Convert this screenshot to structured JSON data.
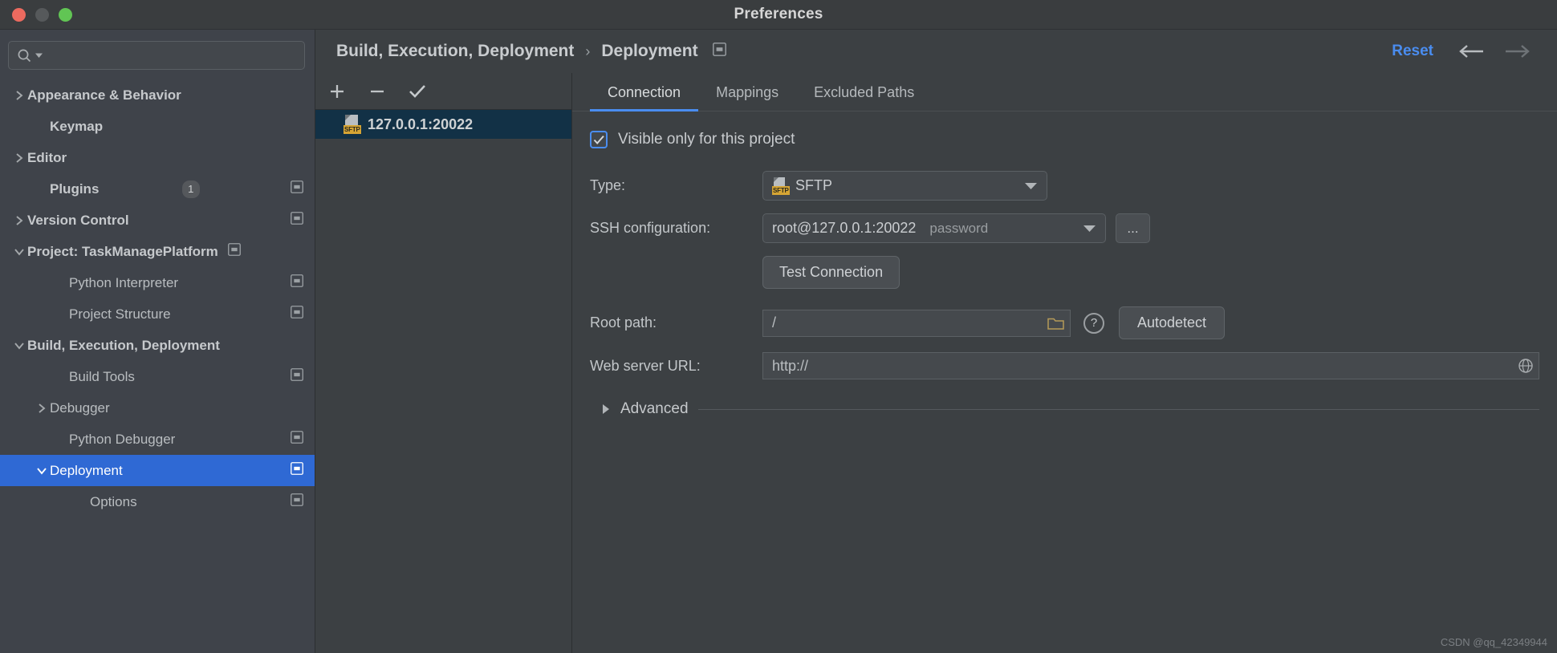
{
  "window": {
    "title": "Preferences",
    "traffic_lights": [
      "close-red",
      "minimize-yellow",
      "zoom-green"
    ]
  },
  "sidebar": {
    "search": {
      "value": "",
      "placeholder": ""
    },
    "items": [
      {
        "label": "Appearance & Behavior",
        "arrow": "right",
        "bold": true,
        "indent": 14,
        "badge": null,
        "copy": false
      },
      {
        "label": "Keymap",
        "arrow": "none",
        "bold": true,
        "indent": 42,
        "badge": null,
        "copy": false
      },
      {
        "label": "Editor",
        "arrow": "right",
        "bold": true,
        "indent": 14,
        "badge": null,
        "copy": false
      },
      {
        "label": "Plugins",
        "arrow": "none",
        "bold": true,
        "indent": 42,
        "badge": "1",
        "copy": true
      },
      {
        "label": "Version Control",
        "arrow": "right",
        "bold": true,
        "indent": 14,
        "badge": null,
        "copy": true
      },
      {
        "label": "Project: TaskManagePlatform",
        "arrow": "down",
        "bold": true,
        "indent": 14,
        "badge": null,
        "copy": true,
        "copy_inline": true
      },
      {
        "label": "Python Interpreter",
        "arrow": "none",
        "bold": false,
        "indent": 66,
        "badge": null,
        "copy": true
      },
      {
        "label": "Project Structure",
        "arrow": "none",
        "bold": false,
        "indent": 66,
        "badge": null,
        "copy": true
      },
      {
        "label": "Build, Execution, Deployment",
        "arrow": "down",
        "bold": true,
        "indent": 14,
        "badge": null,
        "copy": false
      },
      {
        "label": "Build Tools",
        "arrow": "none",
        "bold": false,
        "indent": 66,
        "badge": null,
        "copy": true
      },
      {
        "label": "Debugger",
        "arrow": "right",
        "bold": false,
        "indent": 42,
        "badge": null,
        "copy": false
      },
      {
        "label": "Python Debugger",
        "arrow": "none",
        "bold": false,
        "indent": 66,
        "badge": null,
        "copy": true
      },
      {
        "label": "Deployment",
        "arrow": "down",
        "bold": false,
        "indent": 42,
        "badge": null,
        "copy": true,
        "selected": true
      },
      {
        "label": "Options",
        "arrow": "none",
        "bold": false,
        "indent": 92,
        "badge": null,
        "copy": true
      }
    ]
  },
  "header": {
    "breadcrumb": [
      "Build, Execution, Deployment",
      "Deployment"
    ],
    "separator": "›",
    "reset_label": "Reset",
    "back_icon": "arrow-left-icon",
    "forward_icon": "arrow-right-icon",
    "copy_icon": "copy-settings-icon"
  },
  "server_list": {
    "toolbar": {
      "add": "+",
      "remove": "−",
      "set_default": "✓"
    },
    "servers": [
      {
        "name": "127.0.0.1:20022",
        "type_badge": "SFTP",
        "selected": true
      }
    ]
  },
  "tabs": [
    {
      "label": "Connection",
      "active": true
    },
    {
      "label": "Mappings",
      "active": false
    },
    {
      "label": "Excluded Paths",
      "active": false
    }
  ],
  "form": {
    "visible_only": {
      "label": "Visible only for this project",
      "checked": true
    },
    "type": {
      "label": "Type:",
      "value": "SFTP",
      "badge": "SFTP"
    },
    "ssh_configuration": {
      "label": "SSH configuration:",
      "value": "root@127.0.0.1:20022",
      "sub_value": "password",
      "more_button": "..."
    },
    "test_connection": {
      "label": "Test Connection"
    },
    "root_path": {
      "label": "Root path:",
      "value": "/",
      "browse_icon": "folder-icon",
      "help_icon": "question-mark-icon",
      "autodetect_label": "Autodetect"
    },
    "web_server_url": {
      "label": "Web server URL:",
      "value": "http://",
      "globe_icon": "globe-icon"
    },
    "advanced": {
      "label": "Advanced",
      "expanded": false
    }
  },
  "watermark": "CSDN @qq_42349944",
  "colors": {
    "accent_blue": "#4a8df0",
    "selection_blue": "#2f69d4",
    "list_selection": "#123146",
    "sftp_badge": "#d6a534",
    "window_bg": "#3c4043",
    "sidebar_bg": "#3f434a"
  }
}
